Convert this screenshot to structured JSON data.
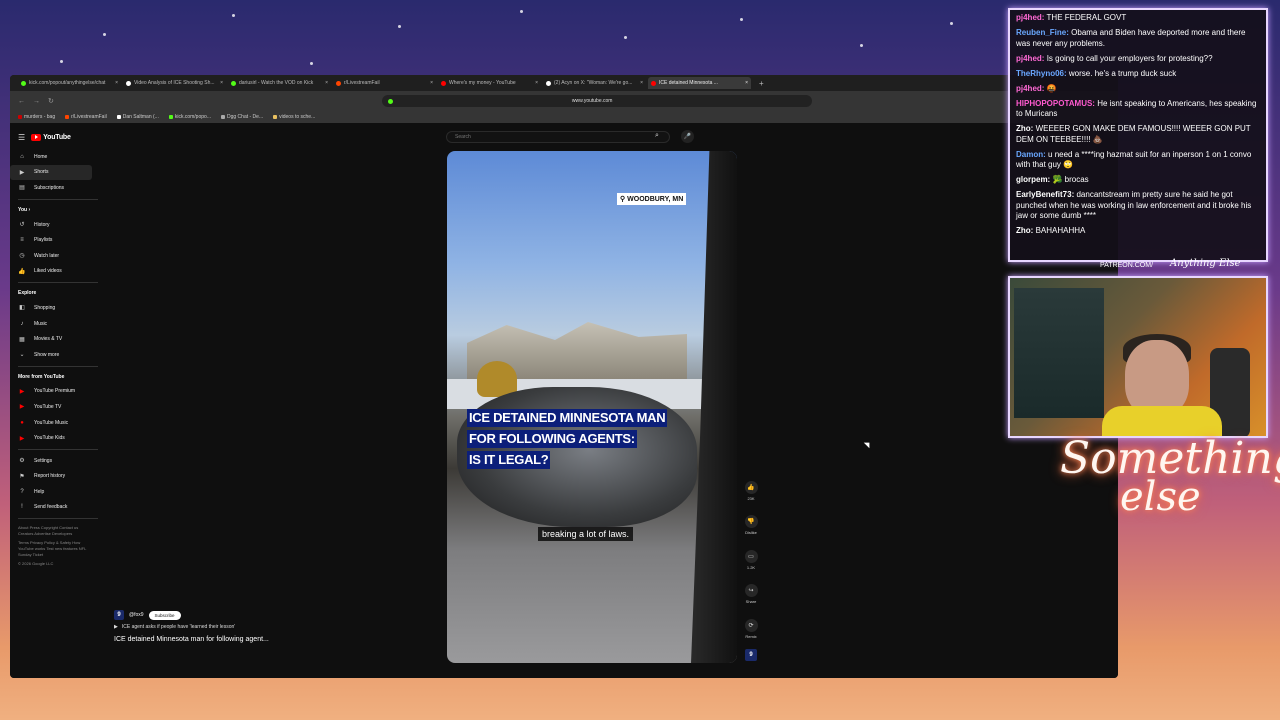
{
  "browser": {
    "tabs": [
      {
        "label": "kick.com/popout/anythingelse/chat",
        "color": "#53fc18",
        "active": false
      },
      {
        "label": "Video Analysis of ICE Shooting Sh...",
        "color": "#ffffff",
        "active": false
      },
      {
        "label": "dariusirl - Watch the VOD on Kick",
        "color": "#53fc18",
        "active": false
      },
      {
        "label": "r/LivestreamFail",
        "color": "#ff4500",
        "active": false
      },
      {
        "label": "Where's my money - YouTube",
        "color": "#ff0000",
        "active": false
      },
      {
        "label": "(2) Acyn on X: \"Woman: We're go...",
        "color": "#ffffff",
        "active": false
      },
      {
        "label": "ICE detained Minnesota ...",
        "color": "#ff0000",
        "active": true
      }
    ],
    "new_tab": "+",
    "url": "www.youtube.com",
    "bookmarks": [
      {
        "label": "murders - bag",
        "color": "#c00"
      },
      {
        "label": "r/LivestreamFail",
        "color": "#ff4500"
      },
      {
        "label": "Dan Saltman (...",
        "color": "#fff"
      },
      {
        "label": "kick.com/popo...",
        "color": "#53fc18"
      },
      {
        "label": "Dgg Chat - De...",
        "color": "#aaa"
      },
      {
        "label": "videos to sche...",
        "color": "#e8c060"
      }
    ]
  },
  "youtube": {
    "logo": "YouTube",
    "search_placeholder": "Search",
    "nav_main": [
      {
        "label": "Home",
        "icon": "home-icon",
        "glyph": "⌂"
      },
      {
        "label": "Shorts",
        "icon": "shorts-icon",
        "glyph": "▶",
        "active": true
      },
      {
        "label": "Subscriptions",
        "icon": "subscriptions-icon",
        "glyph": "▤"
      }
    ],
    "you_label": "You",
    "nav_you": [
      {
        "label": "History",
        "icon": "history-icon",
        "glyph": "↺"
      },
      {
        "label": "Playlists",
        "icon": "playlists-icon",
        "glyph": "≡"
      },
      {
        "label": "Watch later",
        "icon": "clock-icon",
        "glyph": "◷"
      },
      {
        "label": "Liked videos",
        "icon": "thumbs-up-icon",
        "glyph": "👍"
      }
    ],
    "explore_label": "Explore",
    "nav_explore": [
      {
        "label": "Shopping",
        "icon": "shopping-icon",
        "glyph": "◧"
      },
      {
        "label": "Music",
        "icon": "music-icon",
        "glyph": "♪"
      },
      {
        "label": "Movies & TV",
        "icon": "movies-icon",
        "glyph": "▦"
      },
      {
        "label": "Show more",
        "icon": "chevron-down-icon",
        "glyph": "⌄"
      }
    ],
    "more_label": "More from YouTube",
    "nav_more": [
      {
        "label": "YouTube Premium",
        "icon": "yt-premium-icon",
        "glyph": "▶"
      },
      {
        "label": "YouTube TV",
        "icon": "yt-tv-icon",
        "glyph": "▶"
      },
      {
        "label": "YouTube Music",
        "icon": "yt-music-icon",
        "glyph": "●"
      },
      {
        "label": "YouTube Kids",
        "icon": "yt-kids-icon",
        "glyph": "▶"
      }
    ],
    "nav_settings": [
      {
        "label": "Settings",
        "icon": "gear-icon",
        "glyph": "⚙"
      },
      {
        "label": "Report history",
        "icon": "flag-icon",
        "glyph": "⚑"
      },
      {
        "label": "Help",
        "icon": "help-icon",
        "glyph": "?"
      },
      {
        "label": "Send feedback",
        "icon": "feedback-icon",
        "glyph": "!"
      }
    ],
    "footer_1": "About Press Copyright Contact us Creators Advertise Developers",
    "footer_2": "Terms Privacy Policy & Safety How YouTube works Test new features NFL Sunday Ticket",
    "footer_3": "© 2026 Google LLC",
    "short": {
      "location": "WOODBURY, MN",
      "headline_1": "ICE DETAINED MINNESOTA MAN",
      "headline_2": "FOR FOLLOWING AGENTS:",
      "headline_3": "IS IT LEGAL?",
      "caption": "breaking a lot of laws.",
      "actions": [
        {
          "label": "23K",
          "icon": "thumbs-up-icon",
          "glyph": "👍"
        },
        {
          "label": "Dislike",
          "icon": "thumbs-down-icon",
          "glyph": "👎"
        },
        {
          "label": "1.2K",
          "icon": "comment-icon",
          "glyph": "▭"
        },
        {
          "label": "Share",
          "icon": "share-icon",
          "glyph": "↪"
        },
        {
          "label": "Remix",
          "icon": "remix-icon",
          "glyph": "⟳"
        }
      ],
      "channel_badge": "9",
      "channel": "@fox9",
      "subscribe": "Subscribe",
      "related": "ICE agent asks if people have 'learned their lesson'",
      "title": "ICE detained Minnesota man for following agent..."
    }
  },
  "chat": {
    "messages": [
      {
        "name": "pj4hed:",
        "color": "#ff6ad5",
        "text": "THE FEDERAL GOVT"
      },
      {
        "name": "Reuben_Fine:",
        "color": "#6aa8ff",
        "text": "Obama and Biden have deported more and there was never any problems."
      },
      {
        "name": "pj4hed:",
        "color": "#ff6ad5",
        "text": "Is going to call your employers for protesting??"
      },
      {
        "name": "TheRhyno06:",
        "color": "#6aa8ff",
        "text": "worse. he's a trump duck suck"
      },
      {
        "name": "pj4hed:",
        "color": "#ff6ad5",
        "text": "🤬"
      },
      {
        "name": "HIPHOPOPOTAMUS:",
        "color": "#ff5ad0",
        "text": "He isnt speaking to Americans, hes speaking to Muricans"
      },
      {
        "name": "Zho:",
        "color": "#ffffff",
        "text": "WEEEER GON MAKE DEM FAMOUS!!!! WEEER GON PUT DEM ON TEEBEE!!!! 💩"
      },
      {
        "name": "Damon:",
        "color": "#6aa8ff",
        "text": "u need a ****ing hazmat suit for an inperson 1 on 1 convo with that guy 🙄"
      },
      {
        "name": "glorpem:",
        "color": "#ffffff",
        "text": "🥦 brocas"
      },
      {
        "name": "EarlyBenefit73:",
        "color": "#ffffff",
        "text": "dancantstream im pretty sure he said he got punched when he was working in law enforcement and it broke his jaw or some dumb ****"
      },
      {
        "name": "Zho:",
        "color": "#ffffff",
        "text": "BAHAHAHHA"
      }
    ]
  },
  "overlay": {
    "patreon": "PATREON.COM/",
    "brand": "Anything Else",
    "something_1": "Something",
    "something_2": "else"
  }
}
